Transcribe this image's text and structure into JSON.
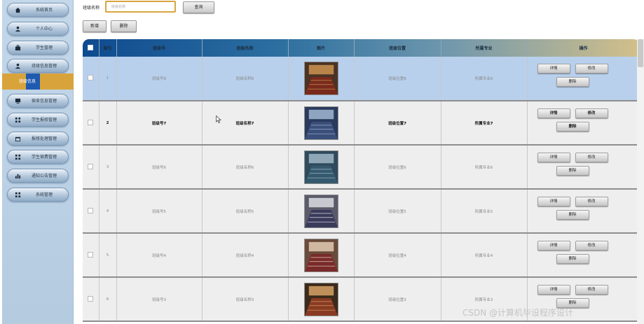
{
  "sidebar": {
    "items": [
      {
        "label": "系统首页",
        "icon": "home-icon"
      },
      {
        "label": "个人中心",
        "icon": "user-icon"
      },
      {
        "label": "学生管理",
        "icon": "briefcase-icon"
      },
      {
        "label": "班级信息管理",
        "icon": "user-icon"
      },
      {
        "label": "宿舍信息管理",
        "icon": "monitor-icon"
      },
      {
        "label": "学生报修管理",
        "icon": "grid-icon"
      },
      {
        "label": "报修处理管理",
        "icon": "calendar-icon"
      },
      {
        "label": "学生宿费管理",
        "icon": "grid-icon"
      },
      {
        "label": "通知公告管理",
        "icon": "bar-chart-icon"
      },
      {
        "label": "系统管理",
        "icon": "grid-icon"
      }
    ],
    "active_submenu": {
      "label": "班级信息"
    },
    "accent_color": "#d9a33b"
  },
  "toolbar": {
    "search_label": "班级名称",
    "search_placeholder": "班级名称",
    "query_label": "查询",
    "add_label": "新增",
    "delete_label": "删除"
  },
  "table": {
    "columns": [
      "索引",
      "班级号",
      "班级名称",
      "图片",
      "班级位置",
      "所属专业",
      "操作"
    ],
    "rows": [
      {
        "index": "1",
        "class_no": "班级号8",
        "class_name": "班级名称8",
        "location": "班级位置8",
        "major": "所属专业8"
      },
      {
        "index": "2",
        "class_no": "班级号7",
        "class_name": "班级名称7",
        "location": "班级位置7",
        "major": "所属专业7"
      },
      {
        "index": "3",
        "class_no": "班级号6",
        "class_name": "班级名称6",
        "location": "班级位置6",
        "major": "所属专业6"
      },
      {
        "index": "4",
        "class_no": "班级号5",
        "class_name": "班级名称5",
        "location": "班级位置5",
        "major": "所属专业5"
      },
      {
        "index": "5",
        "class_no": "班级号4",
        "class_name": "班级名称4",
        "location": "班级位置4",
        "major": "所属专业4"
      },
      {
        "index": "6",
        "class_no": "班级号3",
        "class_name": "班级名称3",
        "location": "班级位置3",
        "major": "所属专业3"
      }
    ],
    "actions": {
      "detail": "详情",
      "edit": "修改",
      "delete": "删除"
    },
    "selected_row_color": "#b8d0ec"
  },
  "watermark": "CSDN @计算机毕设程序设计"
}
